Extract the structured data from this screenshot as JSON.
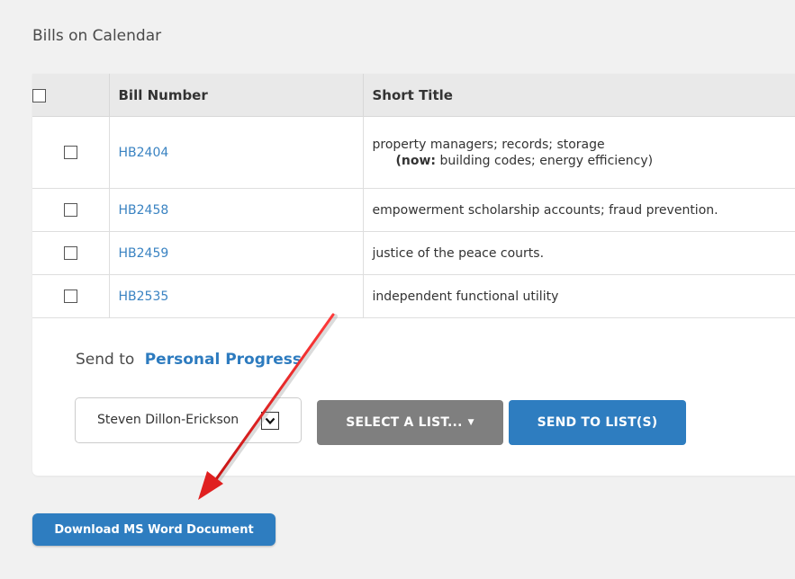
{
  "section": {
    "title": "Bills on Calendar"
  },
  "table": {
    "headers": {
      "bill_number": "Bill Number",
      "short_title": "Short Title"
    },
    "rows": [
      {
        "bill": "HB2404",
        "title": "property managers; records; storage",
        "now_label": "(now:",
        "now_text": " building codes; energy efficiency)"
      },
      {
        "bill": "HB2458",
        "title": "empowerment scholarship accounts; fraud prevention."
      },
      {
        "bill": "HB2459",
        "title": "justice of the peace courts."
      },
      {
        "bill": "HB2535",
        "title": "independent functional utility"
      }
    ]
  },
  "send": {
    "prefix": "Send to",
    "target": "Personal Progress"
  },
  "member_select": {
    "value": "Steven Dillon-Erickson"
  },
  "buttons": {
    "select_list": "SELECT A LIST...",
    "send_to_lists": "SEND TO LIST(S)",
    "download": "Download MS Word Document"
  },
  "colors": {
    "link": "#3a83c2",
    "primary_button": "#2e7dc0",
    "secondary_button": "#7f7f7f",
    "annotation_arrow": "#e02020"
  },
  "icons": {
    "select_caret": "caret-down-icon",
    "dropdown": "chevron-down-icon",
    "annotation": "red-arrow-icon"
  }
}
